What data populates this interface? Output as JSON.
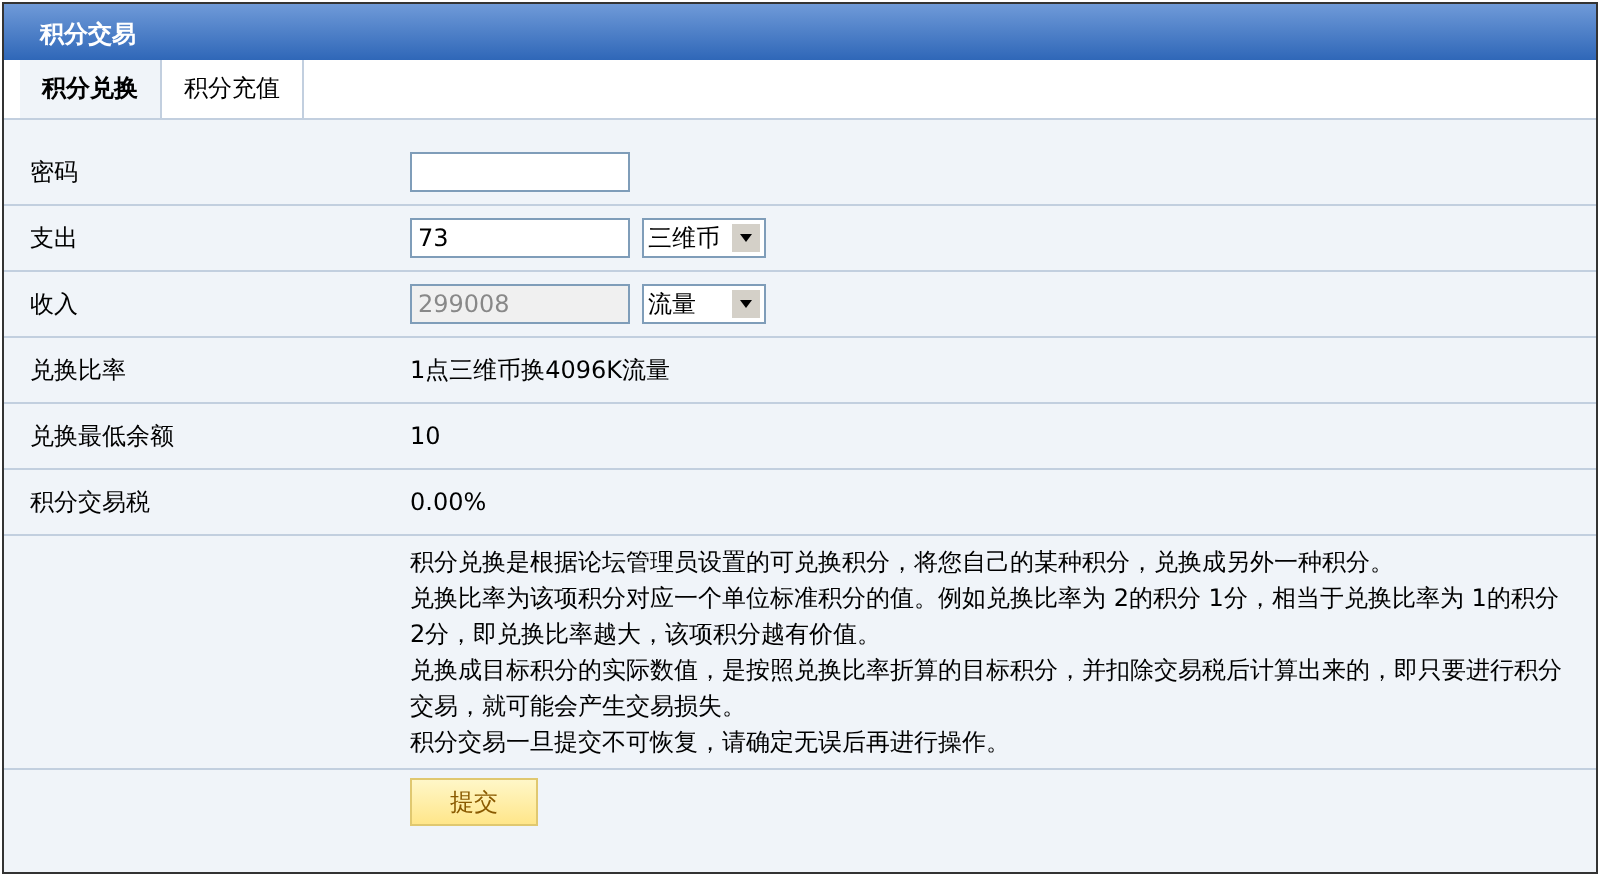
{
  "panel": {
    "title": "积分交易"
  },
  "tabs": [
    {
      "label": "积分兑换",
      "selected": true
    },
    {
      "label": "积分充值",
      "selected": false
    }
  ],
  "rows": [
    {
      "kind": "password",
      "label": "密码",
      "value": ""
    },
    {
      "kind": "input",
      "label": "支出",
      "value": "73",
      "disabled": false,
      "select": "三维币"
    },
    {
      "kind": "input",
      "label": "收入",
      "value": "299008",
      "disabled": true,
      "select": "流量"
    },
    {
      "kind": "text",
      "label": "兑换比率",
      "value": "1点三维币换4096K流量"
    },
    {
      "kind": "text",
      "label": "兑换最低余额",
      "value": "10"
    },
    {
      "kind": "text",
      "label": "积分交易税",
      "value": "0.00%"
    }
  ],
  "notes": [
    "积分兑换是根据论坛管理员设置的可兑换积分，将您自己的某种积分，兑换成另外一种积分。",
    "兑换比率为该项积分对应一个单位标准积分的值。例如兑换比率为  2的积分  1分，相当于兑换比率为  1的积分  2分，即兑换比率越大，该项积分越有价值。",
    "兑换成目标积分的实际数值，是按照兑换比率折算的目标积分，并扣除交易税后计算出来的，即只要进行积分交易，就可能会产生交易损失。",
    "积分交易一旦提交不可恢复，请确定无误后再进行操作。"
  ],
  "submit": "提交"
}
